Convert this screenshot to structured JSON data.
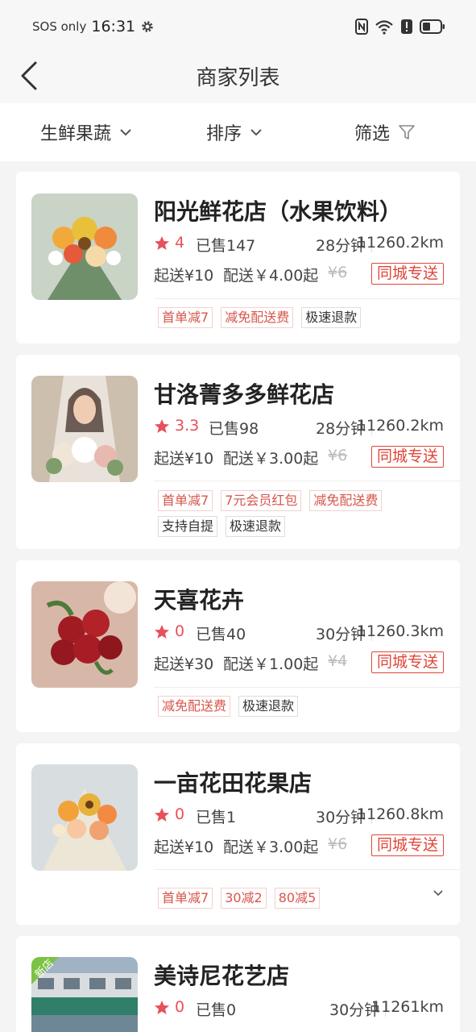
{
  "status_bar": {
    "carrier": "SOS only",
    "time": "16:31"
  },
  "header": {
    "title": "商家列表"
  },
  "filters": [
    {
      "label": "生鲜果蔬"
    },
    {
      "label": "排序"
    },
    {
      "label": "筛选"
    }
  ],
  "shops": [
    {
      "name": "阳光鲜花店（水果饮料）",
      "rating": "4",
      "sold": "已售147",
      "time": "28分钟",
      "distance": "11260.2km",
      "min_order": "起送¥10",
      "delivery_fee": "配送￥4.00起",
      "original_fee": "¥6",
      "badge": "同城专送",
      "tags": [
        {
          "text": "首单减7",
          "style": "red"
        },
        {
          "text": "减免配送费",
          "style": "red"
        },
        {
          "text": "极速退款",
          "style": "plain"
        }
      ]
    },
    {
      "name": "甘洛菁多多鲜花店",
      "rating": "3.3",
      "sold": "已售98",
      "time": "28分钟",
      "distance": "11260.2km",
      "min_order": "起送¥10",
      "delivery_fee": "配送￥3.00起",
      "original_fee": "¥6",
      "badge": "同城专送",
      "tags": [
        {
          "text": "首单减7",
          "style": "red"
        },
        {
          "text": "7元会员红包",
          "style": "red"
        },
        {
          "text": "减免配送费",
          "style": "red"
        },
        {
          "text": "支持自提",
          "style": "plain"
        },
        {
          "text": "极速退款",
          "style": "plain"
        }
      ]
    },
    {
      "name": "天喜花卉",
      "rating": "0",
      "sold": "已售40",
      "time": "30分钟",
      "distance": "11260.3km",
      "min_order": "起送¥30",
      "delivery_fee": "配送￥1.00起",
      "original_fee": "¥4",
      "badge": "同城专送",
      "tags": [
        {
          "text": "减免配送费",
          "style": "red"
        },
        {
          "text": "极速退款",
          "style": "plain"
        }
      ]
    },
    {
      "name": "一亩花田花果店",
      "rating": "0",
      "sold": "已售1",
      "time": "30分钟",
      "distance": "11260.8km",
      "min_order": "起送¥10",
      "delivery_fee": "配送￥3.00起",
      "original_fee": "¥6",
      "badge": "同城专送",
      "tags": [
        {
          "text": "首单减7",
          "style": "red"
        },
        {
          "text": "30减2",
          "style": "red"
        },
        {
          "text": "80减5",
          "style": "red"
        }
      ]
    },
    {
      "name": "美诗尼花艺店",
      "rating": "0",
      "sold": "已售0",
      "time": "30分钟",
      "distance": "11261km",
      "ribbon": "新店"
    }
  ],
  "colors": {
    "accent": "#e0463a",
    "star": "#e8505b"
  }
}
